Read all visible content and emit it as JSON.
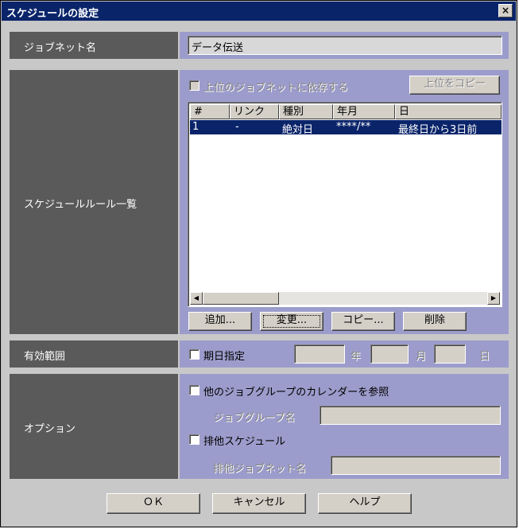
{
  "window": {
    "title": "スケジュールの設定",
    "close_glyph": "×"
  },
  "jobnet_name": {
    "label": "ジョブネット名",
    "value": "データ伝送"
  },
  "schedule_rules": {
    "label": "スケジュールルール一覧",
    "depend_upper_checkbox": "上位のジョブネットに依存する",
    "copy_upper_button": "上位をコピー",
    "columns": [
      "#",
      "リンク",
      "種別",
      "年月",
      "日"
    ],
    "rows": [
      {
        "num": "1",
        "link": "-",
        "type": "絶対日",
        "yearmonth": "****/**",
        "day": "最終日から3日前",
        "selected": true
      }
    ],
    "add_button": "追加...",
    "change_button": "変更...",
    "copy_button": "コピー...",
    "delete_button": "削除"
  },
  "valid_range": {
    "label": "有効範囲",
    "due_date_checkbox": "期日指定",
    "year_unit": "年",
    "month_unit": "月",
    "day_unit": "日",
    "year_value": "",
    "month_value": "",
    "day_value": ""
  },
  "options": {
    "label": "オプション",
    "calendar_checkbox": "他のジョブグループのカレンダーを参照",
    "jobgroup_name_label": "ジョブグループ名",
    "jobgroup_name_value": "",
    "exclusive_checkbox": "排他スケジュール",
    "exclusive_jobnet_label": "排他ジョブネット名",
    "exclusive_jobnet_value": ""
  },
  "footer": {
    "ok": "ＯＫ",
    "cancel": "キャンセル",
    "help": "ヘルプ"
  },
  "colors": {
    "title_bar": "#0a246a",
    "label_bg": "#5a5a5a",
    "panel_bg": "#9c9ccc",
    "selection": "#0a246a"
  }
}
